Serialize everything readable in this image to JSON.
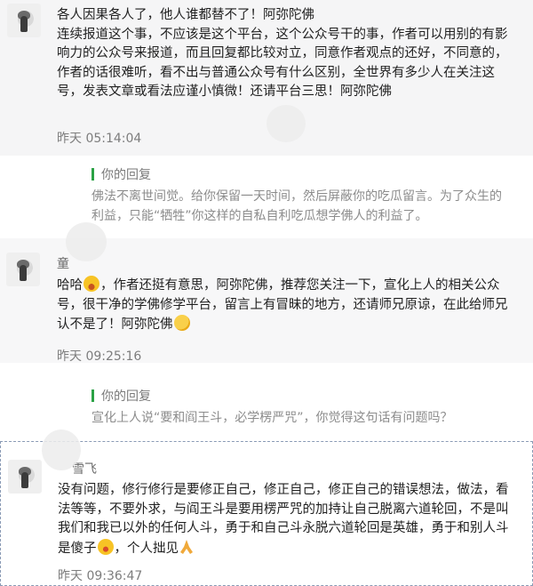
{
  "comments": [
    {
      "name": "",
      "text": "各人因果各人了，他人谁都替不了！阿弥陀佛\n连续报道这个事，不应该是这个平台，这个公众号干的事，作者可以用别的有影响力的公众号来报道，而且回复都比较对立，同意作者观点的还好，不同意的，作者的话很难听，看不出与普通公众号有什么区别，全世界有多少人在关注这号，发表文章或看法应谨小慎微！还请平台三思！阿弥陀佛",
      "time": "昨天 05:14:04",
      "reply_label": "你的回复",
      "reply_text": "佛法不离世间觉。给你保留一天时间，然后屏蔽你的吃瓜留言。为了众生的利益，只能“牺牲”你这样的自私自利吃瓜想学佛人的利益了。"
    },
    {
      "name": "童",
      "text_a": "哈哈",
      "text_b": "，作者还挺有意思，阿弥陀佛，推荐您关注一下，宣化上人的相关公众号，很干净的学佛修学平台，留言上有冒昧的地方，还请师兄原谅，在此给师兄认不是了！阿弥陀佛",
      "time": "昨天 09:25:16",
      "reply_label": "你的回复",
      "reply_text": "宣化上人说“要和阎王斗，必学楞严咒”，你觉得这句话有问题吗？"
    },
    {
      "name": "雪飞",
      "text_a": "没有问题，修行修行是要修正自己，修正自己，修正自己的错误想法，做法，看法等等，不要外求，与阎王斗是要用楞严咒的加持让自己脱离六道轮回，不是叫我们和我已以外的任何人斗，勇于和自己斗永脱六道轮回是英雄，勇于和别人斗是傻子",
      "text_b": "，个人拙见",
      "time": "昨天 09:36:47"
    }
  ]
}
